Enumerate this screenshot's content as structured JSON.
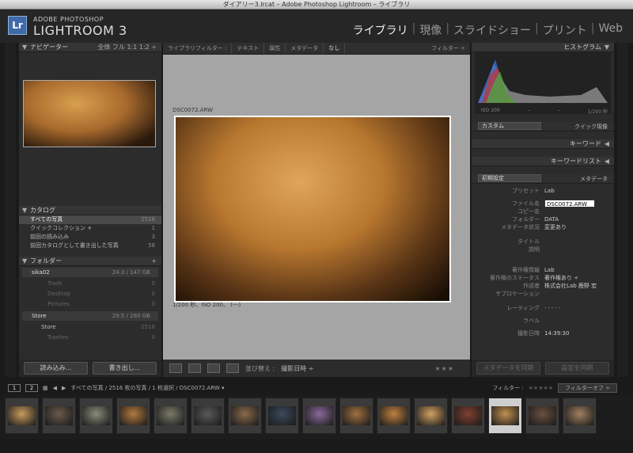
{
  "window": {
    "title": "ダイアリー3.lrcat – Adobe Photoshop Lightroom – ライブラリ"
  },
  "brand": {
    "line1": "ADOBE PHOTOSHOP",
    "line2": "LIGHTROOM 3",
    "logo": "Lr"
  },
  "modules": [
    {
      "label": "ライブラリ",
      "active": true
    },
    {
      "label": "現像"
    },
    {
      "label": "スライドショー"
    },
    {
      "label": "プリント"
    },
    {
      "label": "Web"
    }
  ],
  "navigator": {
    "title": "ナビゲーター",
    "options": "全体  フル  1:1  1:2 ÷"
  },
  "catalog": {
    "title": "カタログ",
    "items": [
      {
        "label": "すべての写真",
        "count": "2516",
        "selected": true
      },
      {
        "label": "クイックコレクション +",
        "count": "1"
      },
      {
        "label": "前回の読み込み",
        "count": "3"
      },
      {
        "label": "前回カタログとして書き出した写真",
        "count": "58"
      }
    ]
  },
  "folders": {
    "title": "フォルダー",
    "add": "+",
    "vol1": {
      "name": "sika02",
      "info": "24.3 / 147 GB"
    },
    "vol1_items": [
      {
        "name": "Trash",
        "count": "0"
      },
      {
        "name": "Desktop",
        "count": "0"
      },
      {
        "name": "Pictures",
        "count": "0"
      }
    ],
    "vol2": {
      "name": "Store",
      "info": "29.5 / 280 GB"
    },
    "vol2_items": [
      {
        "name": "Store",
        "count": "2516"
      },
      {
        "name": "Trashes",
        "count": "0"
      }
    ]
  },
  "left_buttons": {
    "import": "読み込み...",
    "export": "書き出し..."
  },
  "filterbar": {
    "label": "ライブラリフィルター :",
    "items": [
      "テキスト",
      "属性",
      "メタデータ",
      "なし"
    ],
    "filter": "フィルター ÷"
  },
  "photo": {
    "filename": "DSC0072.ARW",
    "info": "1/200 秒、ISO 200、 (---)"
  },
  "toolbar": {
    "sort_label": "並び替え :",
    "sort_value": "撮影日時 ÷",
    "stars": "★★★"
  },
  "histogram": {
    "title": "ヒストグラム",
    "iso": "ISO 200",
    "dash1": "–",
    "dash2": "–",
    "shutter": "1/200 秒"
  },
  "quick_develop": {
    "preset": "カスタム",
    "title": "クイック現像"
  },
  "keywords": {
    "title": "キーワード"
  },
  "keyword_list": {
    "title": "キーワードリスト"
  },
  "metadata": {
    "preset": "初期設定",
    "title": "メタデータ",
    "rows": [
      {
        "k": "プリセット",
        "v": "Lab"
      },
      {
        "k": "ファイル名",
        "v": "DSC0072.ARW"
      },
      {
        "k": "コピー名",
        "v": ""
      },
      {
        "k": "フォルダー",
        "v": "DATA"
      },
      {
        "k": "メタデータ状況",
        "v": "変更あり"
      },
      {
        "k": "タイトル",
        "v": ""
      },
      {
        "k": "説明",
        "v": ""
      },
      {
        "k": "著作権情報",
        "v": "Lab"
      },
      {
        "k": "著作権のステータス",
        "v": "著作権あり ÷"
      },
      {
        "k": "作成者",
        "v": "株式会社Lab 鹿野 宏"
      },
      {
        "k": "サブロケーション",
        "v": ""
      },
      {
        "k": "レーティング",
        "v": "· · · · ·"
      },
      {
        "k": "ラベル",
        "v": ""
      },
      {
        "k": "撮影日時",
        "v": "14:39:30"
      }
    ]
  },
  "right_buttons": {
    "sync_meta": "メタデータを同期",
    "sync_settings": "設定を同期"
  },
  "filmbar": {
    "page1": "1",
    "page2": "2",
    "path": "すべての写真 / 2516 枚の写真 / 1 枚選択 / DSC0072.ARW ▾",
    "filter": "フィルター :",
    "filter_off": "フィルターオフ ÷"
  },
  "thumbs_count": 16
}
